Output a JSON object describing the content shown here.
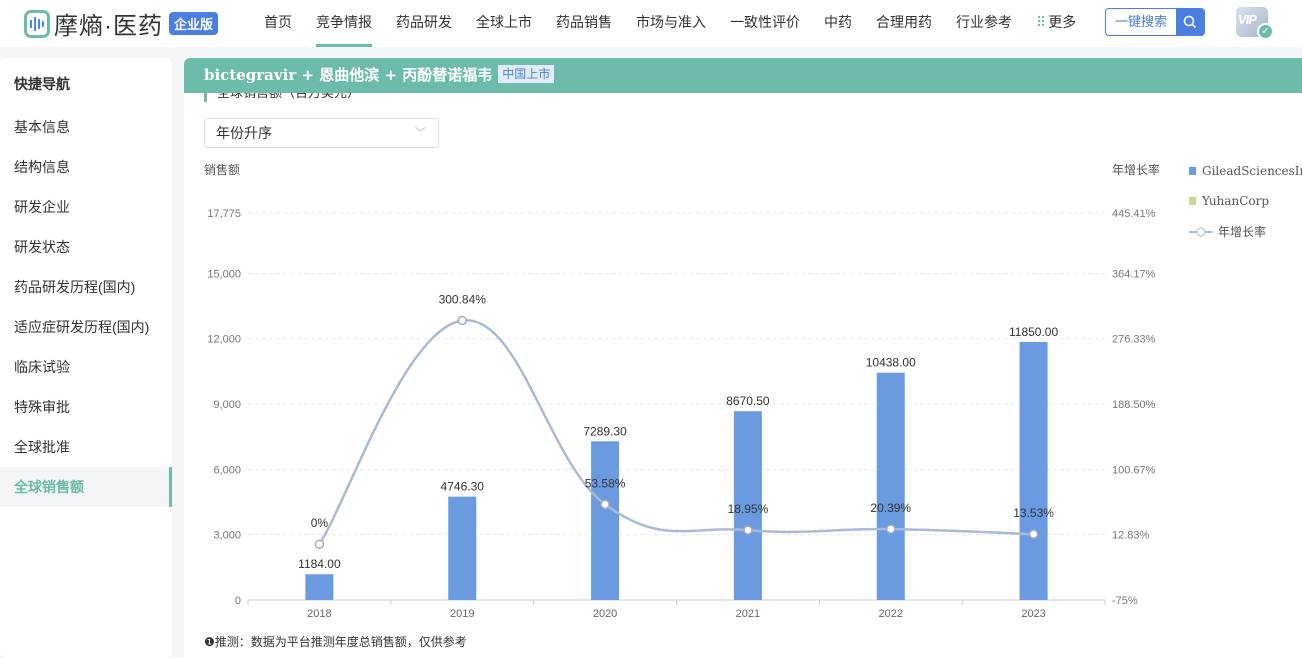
{
  "header": {
    "logo_text": "摩熵·医药",
    "logo_badge": "企业版",
    "nav": [
      "首页",
      "竞争情报",
      "药品研发",
      "全球上市",
      "药品销售",
      "市场与准入",
      "一致性评价",
      "中药",
      "合理用药",
      "行业参考"
    ],
    "nav_more": "更多",
    "search_label": "一键搜索",
    "vip_label": "VIP"
  },
  "sidebar": {
    "title": "快捷导航",
    "items": [
      "基本信息",
      "结构信息",
      "研发企业",
      "研发状态",
      "药品研发历程(国内)",
      "适应症研发历程(国内)",
      "临床试验",
      "特殊审批",
      "全球批准",
      "全球销售额"
    ],
    "active": 9
  },
  "banner": {
    "title": "bictegravir + 恩曲他滨 + 丙酚替诺福韦",
    "tag": "中国上市"
  },
  "section_title": "全球销售额（百万美元）",
  "sort_select": {
    "value": "年份升序"
  },
  "note": "❶推测：数据为平台推测年度总销售额，仅供参考",
  "colors": {
    "accent": "#6dbbaa",
    "bar": "#6a9be0",
    "yuhan": "#c8d890",
    "line": "#a9bad6",
    "brand": "#4a7ee0"
  },
  "chart_data": {
    "type": "bar",
    "categories": [
      "2018",
      "2019",
      "2020",
      "2021",
      "2022",
      "2023"
    ],
    "series": [
      {
        "name": "GileadSciencesInc",
        "type": "bar",
        "axis": "left",
        "values": [
          1184.0,
          4746.3,
          7289.3,
          8670.5,
          10438.0,
          11850.0
        ],
        "labels": [
          "1184.00",
          "4746.30",
          "7289.30",
          "8670.50",
          "10438.00",
          "11850.00"
        ]
      },
      {
        "name": "YuhanCorp",
        "type": "bar",
        "axis": "left",
        "values": []
      },
      {
        "name": "年增长率",
        "type": "line",
        "axis": "right",
        "values": [
          0,
          300.84,
          53.58,
          18.95,
          20.39,
          13.53
        ],
        "labels": [
          "0%",
          "300.84%",
          "53.58%",
          "18.95%",
          "20.39%",
          "13.53%"
        ]
      }
    ],
    "ylabel": "销售额",
    "y2label": "年增长率",
    "ylim": [
      0,
      17775
    ],
    "yticks": [
      "0",
      "3,000",
      "6,000",
      "9,000",
      "12,000",
      "15,000",
      "17,775"
    ],
    "ytick_values": [
      0,
      3000,
      6000,
      9000,
      12000,
      15000,
      17775
    ],
    "y2lim": [
      -75,
      445.41
    ],
    "y2ticks": [
      "-75%",
      "12.83%",
      "100.67%",
      "188.50%",
      "276.33%",
      "364.17%",
      "445.41%"
    ],
    "y2tick_values": [
      -75,
      12.83,
      100.67,
      188.5,
      276.33,
      364.17,
      445.41
    ],
    "legend": "right",
    "grid": true
  }
}
